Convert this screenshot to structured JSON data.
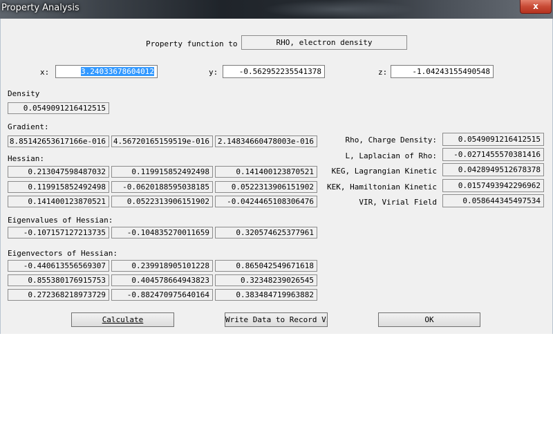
{
  "window": {
    "title": "Property Analysis",
    "close_label": "x"
  },
  "property": {
    "label": "Property function to",
    "value": "RHO, electron density"
  },
  "coords": {
    "x_label": "x:",
    "x_value": "3.24033678604012",
    "y_label": "y:",
    "y_value": "-0.562952235541378",
    "z_label": "z:",
    "z_value": "-1.04243155490548"
  },
  "density": {
    "label": "Density",
    "value": "0.0549091216412515"
  },
  "gradient": {
    "label": "Gradient:",
    "values": [
      "8.85142653617166e-016",
      "4.56720165159519e-016",
      "2.14834660478003e-016"
    ]
  },
  "hessian": {
    "label": "Hessian:",
    "rows": [
      [
        "0.213047598487032",
        "0.119915852492498",
        "0.141400123870521"
      ],
      [
        "0.119915852492498",
        "-0.0620188595038185",
        "0.0522313906151902"
      ],
      [
        "0.141400123870521",
        "0.0522313906151902",
        "-0.0424465108306476"
      ]
    ]
  },
  "eigenvalues": {
    "label": "Eigenvalues of Hessian:",
    "values": [
      "-0.107157127213735",
      "-0.104835270011659",
      "0.320574625377961"
    ]
  },
  "eigenvectors": {
    "label": "Eigenvectors of Hessian:",
    "rows": [
      [
        "-0.440613556569307",
        "0.239918905101228",
        "0.865042549671618"
      ],
      [
        "0.855380176915753",
        "0.404578664943823",
        "0.32348239026545"
      ],
      [
        "0.272368218973729",
        "-0.882470975640164",
        "0.383484719963882"
      ]
    ]
  },
  "properties": [
    {
      "label": "Rho, Charge Density:",
      "value": "0.0549091216412515"
    },
    {
      "label": "L, Laplacian of Rho:",
      "value": "-0.0271455570381416"
    },
    {
      "label": "KEG, Lagrangian Kinetic",
      "value": "0.0428949512678378"
    },
    {
      "label": "KEK, Hamiltonian Kinetic",
      "value": "0.0157493942296962"
    },
    {
      "label": "VIR, Virial Field",
      "value": "0.058644345497534"
    }
  ],
  "buttons": {
    "calculate": "Calculate",
    "write": "Write Data to Record View",
    "ok": "OK"
  }
}
